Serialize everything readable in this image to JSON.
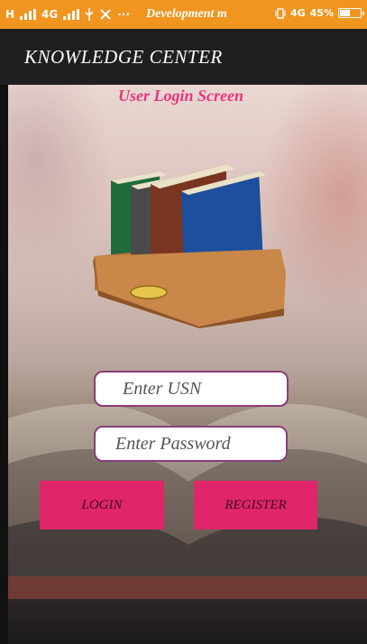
{
  "status_bar": {
    "network_left": "H",
    "network_4g": "4G",
    "center_text": "Development m",
    "network_right": "4G",
    "battery": "45%",
    "battery_level": 0.45,
    "color": "#f0951f"
  },
  "app_bar": {
    "title": "KNOWLEDGE CENTER",
    "color": "#1f1f1f"
  },
  "screen": {
    "subtitle": "User Login Screen",
    "subtitle_color": "#e8347c",
    "illustration_icon": "books-in-tray-icon"
  },
  "form": {
    "usn_placeholder": "Enter USN",
    "password_placeholder": "Enter Password",
    "input_border_color": "#8a3d7b"
  },
  "buttons": {
    "login_label": "LOGIN",
    "register_label": "REGISTER",
    "color": "#e0256b"
  }
}
